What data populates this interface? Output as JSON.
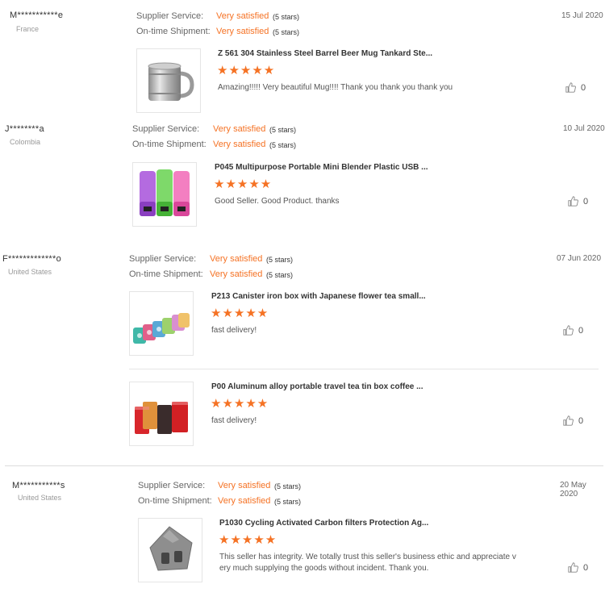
{
  "labels": {
    "supplier_service": "Supplier Service:",
    "ontime_shipment": "On-time Shipment:"
  },
  "reviews": [
    {
      "buyer": "M***********e",
      "country": "France",
      "date": "15 Jul 2020",
      "supplier_rating": "Very satisfied",
      "supplier_stars": "(5 stars)",
      "shipment_rating": "Very satisfied",
      "shipment_stars": "(5 stars)",
      "products": [
        {
          "title": "Z 561 304 Stainless Steel Barrel Beer Mug Tankard Ste...",
          "stars": "★★★★★",
          "comment": "Amazing!!!!! Very beautiful Mug!!!! Thank you thank you thank you",
          "likes": "0"
        }
      ]
    },
    {
      "buyer": "J********a",
      "country": "Colombia",
      "date": "10 Jul 2020",
      "supplier_rating": "Very satisfied",
      "supplier_stars": "(5 stars)",
      "shipment_rating": "Very satisfied",
      "shipment_stars": "(5 stars)",
      "products": [
        {
          "title": "P045 Multipurpose Portable Mini Blender Plastic USB ...",
          "stars": "★★★★★",
          "comment": "Good Seller. Good Product. thanks",
          "likes": "0"
        }
      ]
    },
    {
      "buyer": "F*************o",
      "country": "United States",
      "date": "07 Jun 2020",
      "supplier_rating": "Very satisfied",
      "supplier_stars": "(5 stars)",
      "shipment_rating": "Very satisfied",
      "shipment_stars": "(5 stars)",
      "products": [
        {
          "title": "P213 Canister iron box with Japanese flower tea small...",
          "stars": "★★★★★",
          "comment": "fast delivery!",
          "likes": "0"
        },
        {
          "title": "P00 Aluminum alloy portable travel tea tin box coffee ...",
          "stars": "★★★★★",
          "comment": "fast delivery!",
          "likes": "0"
        }
      ]
    },
    {
      "buyer": "M***********s",
      "country": "United States",
      "date": "20 May 2020",
      "supplier_rating": "Very satisfied",
      "supplier_stars": "(5 stars)",
      "shipment_rating": "Very satisfied",
      "shipment_stars": "(5 stars)",
      "products": [
        {
          "title": "P1030 Cycling Activated Carbon filters Protection Ag...",
          "stars": "★★★★★",
          "comment_line1": "This seller has integrity. We totally trust this seller's business ethic and appreciate v",
          "comment_line2": "ery much supplying the goods without incident. Thank you.",
          "likes": "0"
        }
      ]
    }
  ],
  "icons": {
    "like": "thumbs-up-icon",
    "stars": "star-icon"
  },
  "colors": {
    "accent": "#f57224"
  }
}
